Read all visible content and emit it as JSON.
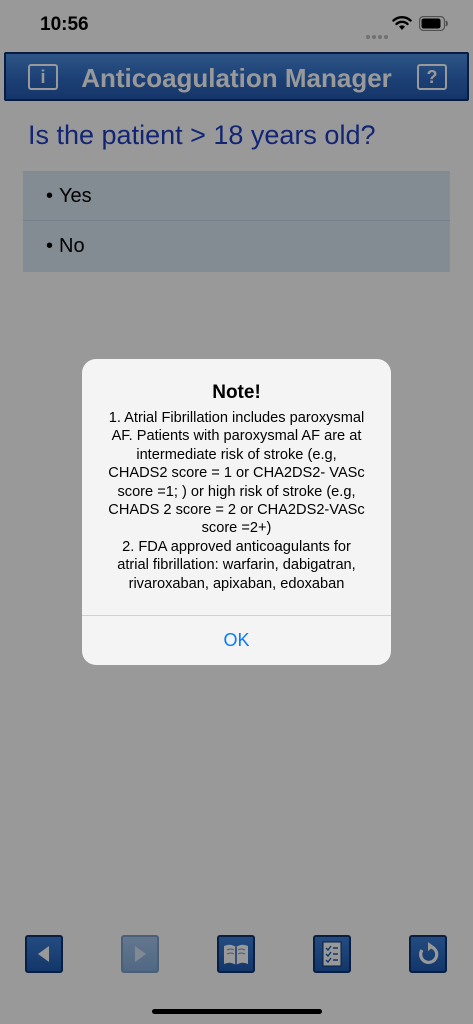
{
  "status_bar": {
    "time": "10:56",
    "icons": [
      "signal-dots-icon",
      "wifi-icon",
      "battery-icon"
    ]
  },
  "header": {
    "title": "Anticoagulation Manager",
    "info_icon": "i",
    "help_icon": "?",
    "color": "#2f6cc4"
  },
  "question": {
    "text": "Is the patient > 18 years old?",
    "color": "#1f3fc4"
  },
  "options": [
    {
      "bullet": "•",
      "label": "Yes"
    },
    {
      "bullet": "•",
      "label": "No"
    }
  ],
  "toolbar": {
    "buttons": [
      {
        "name": "back-button",
        "icon": "left-arrow-icon",
        "enabled": true
      },
      {
        "name": "forward-button",
        "icon": "right-arrow-icon",
        "enabled": false
      },
      {
        "name": "reference-book-button",
        "icon": "book-icon",
        "enabled": true
      },
      {
        "name": "checklist-button",
        "icon": "checklist-icon",
        "enabled": true
      },
      {
        "name": "restart-button",
        "icon": "refresh-icon",
        "enabled": true
      }
    ]
  },
  "alert": {
    "title": "Note!",
    "message_lines": [
      "1. Atrial Fibrillation includes paroxysmal",
      "AF. Patients with paroxysmal AF are at",
      "intermediate risk of stroke (e.g,",
      "CHADS2 score = 1 or CHA2DS2- VASc",
      "score =1; ) or high risk of stroke (e.g,",
      "CHADS 2 score = 2 or CHA2DS2-VASc",
      "score =2+)",
      "2. FDA approved anticoagulants for",
      "atrial fibrillation: warfarin, dabigatran,",
      "rivaroxaban, apixaban, edoxaban"
    ],
    "button_label": "OK",
    "button_color": "#0a7aff"
  }
}
